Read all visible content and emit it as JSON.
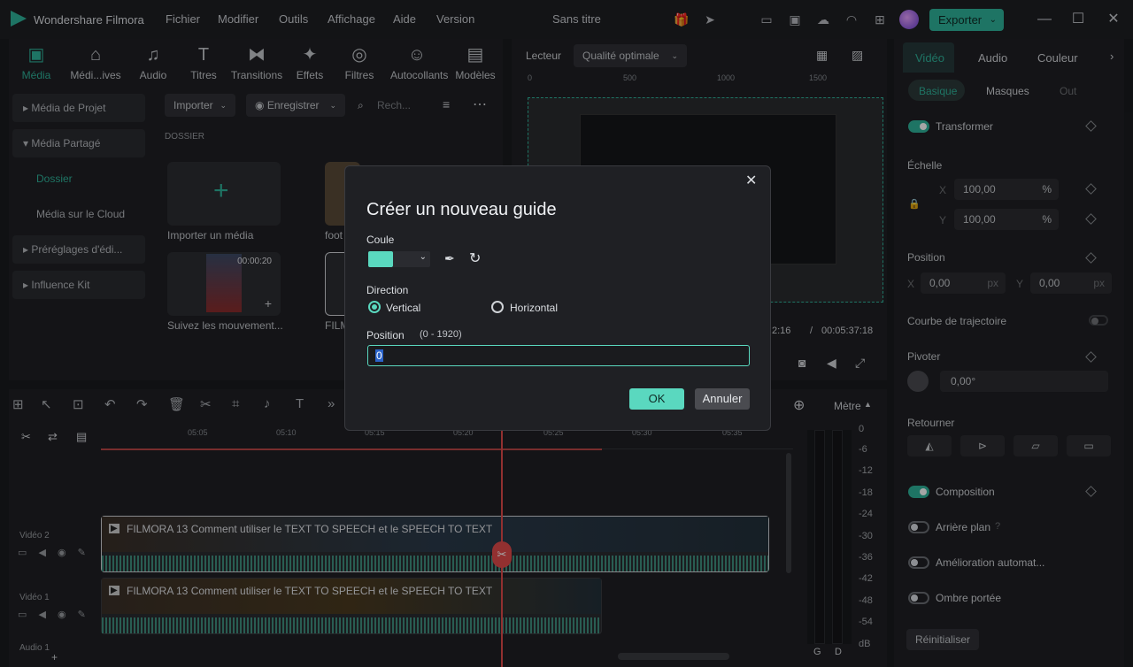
{
  "app": {
    "name": "Wondershare Filmora",
    "doc_title": "Sans titre",
    "export_label": "Exporter"
  },
  "menu": [
    "Fichier",
    "Modifier",
    "Outils",
    "Affichage",
    "Aide",
    "Version"
  ],
  "toolbar": [
    "Média",
    "Médi...ives",
    "Audio",
    "Titres",
    "Transitions",
    "Effets",
    "Filtres",
    "Autocollants",
    "Modèles"
  ],
  "sidebar": [
    "Média de Projet",
    "Média Partagé",
    "Dossier",
    "Média sur le Cloud",
    "Préréglages d'édi...",
    "Influence Kit"
  ],
  "media": {
    "import_btn": "Importer",
    "record_btn": "Enregistrer",
    "search_placeholder": "Rech...",
    "folder_label": "DOSSIER",
    "import_media": "Importer un média",
    "clip1": "foot",
    "clip2": "Suivez les mouvement...",
    "clip3": "FILM",
    "clip2_duration": "00:00:20"
  },
  "player": {
    "label": "Lecteur",
    "quality": "Qualité optimale",
    "ruler": [
      "0",
      "500",
      "1000",
      "1500"
    ],
    "time_current": "2:16",
    "time_sep": "/",
    "time_total": "00:05:37:18"
  },
  "right_panel": {
    "tabs": [
      "Vidéo",
      "Audio",
      "Couleur"
    ],
    "subtabs": [
      "Basique",
      "Masques",
      "Out"
    ],
    "transformer": "Transformer",
    "echelle": "Échelle",
    "x_label": "X",
    "y_label": "Y",
    "scale_x": "100,00",
    "scale_y": "100,00",
    "pct": "%",
    "position": "Position",
    "pos_x": "0,00",
    "pos_y": "0,00",
    "px": "px",
    "courbe": "Courbe de trajectoire",
    "pivoter": "Pivoter",
    "rotate_val": "0,00°",
    "retourner": "Retourner",
    "composition": "Composition",
    "arriere": "Arrière plan",
    "amelioration": "Amélioration automat...",
    "ombre": "Ombre portée",
    "reset": "Réinitialiser"
  },
  "timeline": {
    "metre_label": "Mètre",
    "ruler": [
      "05:05",
      "05:10",
      "05:15",
      "05:20",
      "05:25",
      "05:30",
      "05:35"
    ],
    "tracks": [
      {
        "name": "Vidéo 2",
        "clip": "FILMORA 13  Comment utiliser le TEXT TO SPEECH et le SPEECH TO TEXT"
      },
      {
        "name": "Vidéo 1",
        "clip": "FILMORA 13  Comment utiliser le TEXT TO SPEECH et le SPEECH TO TEXT"
      },
      {
        "name": "Audio 1"
      }
    ],
    "meter_scale": [
      "0",
      "-6",
      "-12",
      "-18",
      "-24",
      "-30",
      "-36",
      "-42",
      "-48",
      "-54",
      "dB"
    ],
    "meter_channels": [
      "G",
      "D"
    ]
  },
  "dialog": {
    "title": "Créer un nouveau guide",
    "color_label": "Coule",
    "color": "#5ad8bf",
    "direction_label": "Direction",
    "vertical": "Vertical",
    "horizontal": "Horizontal",
    "selected": "Vertical",
    "position_label": "Position",
    "position_range": "(0 - 1920)",
    "position_value": "0",
    "ok": "OK",
    "cancel": "Annuler"
  },
  "colors": {
    "accent": "#2fb39a",
    "ok": "#5ad8bf",
    "playhead": "#e04b4b"
  }
}
